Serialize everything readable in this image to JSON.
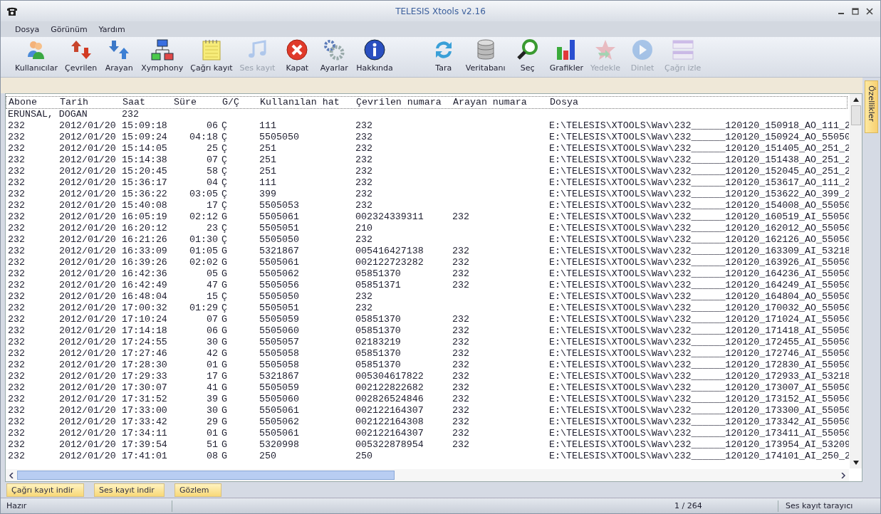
{
  "window": {
    "title": "TELESIS Xtools v2.16"
  },
  "menu": [
    "Dosya",
    "Görünüm",
    "Yardım"
  ],
  "toolbar": {
    "groups": [
      [
        {
          "label": "Kullanıcılar",
          "disabled": false
        },
        {
          "label": "Çevrilen",
          "disabled": false
        },
        {
          "label": "Arayan",
          "disabled": false
        },
        {
          "label": "Xymphony",
          "disabled": false
        },
        {
          "label": "Çağrı kayıt",
          "disabled": false
        },
        {
          "label": "Ses kayıt",
          "disabled": true
        },
        {
          "label": "Kapat",
          "disabled": false
        },
        {
          "label": "Ayarlar",
          "disabled": false
        },
        {
          "label": "Hakkında",
          "disabled": false
        }
      ],
      [
        {
          "label": "Tara",
          "disabled": false
        },
        {
          "label": "Veritabanı",
          "disabled": false
        },
        {
          "label": "Seç",
          "disabled": false
        },
        {
          "label": "Grafikler",
          "disabled": false
        },
        {
          "label": "Yedekle",
          "disabled": true
        },
        {
          "label": "Dinlet",
          "disabled": true
        },
        {
          "label": "Çağrı izle",
          "disabled": true
        }
      ]
    ]
  },
  "side_tab": "Özellikler",
  "table": {
    "columns": [
      "Abone",
      "Tarih",
      "Saat",
      "Süre",
      "G/Ç",
      "Kullanılan hat",
      "Çevrilen numara",
      "Arayan numara",
      "Dosya"
    ],
    "rows": [
      {
        "kind": "group",
        "name": "ERUNSAL, DOGAN",
        "ext": "232"
      },
      {
        "kind": "call",
        "cells": [
          "232",
          "2012/01/20",
          "15:09:18",
          "06",
          "Ç",
          "111",
          "232",
          "",
          "E:\\TELESIS\\XTOOLS\\Wav\\232______120120_150918_AO_111_2"
        ]
      },
      {
        "kind": "call",
        "cells": [
          "232",
          "2012/01/20",
          "15:09:24",
          "04:18",
          "Ç",
          "5505050",
          "232",
          "",
          "E:\\TELESIS\\XTOOLS\\Wav\\232______120120_150924_AO_55050"
        ]
      },
      {
        "kind": "call",
        "cells": [
          "232",
          "2012/01/20",
          "15:14:05",
          "25",
          "Ç",
          "251",
          "232",
          "",
          "E:\\TELESIS\\XTOOLS\\Wav\\232______120120_151405_AO_251_2"
        ]
      },
      {
        "kind": "call",
        "cells": [
          "232",
          "2012/01/20",
          "15:14:38",
          "07",
          "Ç",
          "251",
          "232",
          "",
          "E:\\TELESIS\\XTOOLS\\Wav\\232______120120_151438_AO_251_2"
        ]
      },
      {
        "kind": "call",
        "cells": [
          "232",
          "2012/01/20",
          "15:20:45",
          "58",
          "Ç",
          "251",
          "232",
          "",
          "E:\\TELESIS\\XTOOLS\\Wav\\232______120120_152045_AO_251_2"
        ]
      },
      {
        "kind": "call",
        "cells": [
          "232",
          "2012/01/20",
          "15:36:17",
          "04",
          "Ç",
          "111",
          "232",
          "",
          "E:\\TELESIS\\XTOOLS\\Wav\\232______120120_153617_AO_111_2"
        ]
      },
      {
        "kind": "call",
        "cells": [
          "232",
          "2012/01/20",
          "15:36:22",
          "03:05",
          "Ç",
          "399",
          "232",
          "",
          "E:\\TELESIS\\XTOOLS\\Wav\\232______120120_153622_AO_399_2"
        ]
      },
      {
        "kind": "call",
        "cells": [
          "232",
          "2012/01/20",
          "15:40:08",
          "17",
          "Ç",
          "5505053",
          "232",
          "",
          "E:\\TELESIS\\XTOOLS\\Wav\\232______120120_154008_AO_55050"
        ]
      },
      {
        "kind": "call",
        "cells": [
          "232",
          "2012/01/20",
          "16:05:19",
          "02:12",
          "G",
          "5505061",
          "002324339311",
          "232",
          "E:\\TELESIS\\XTOOLS\\Wav\\232______120120_160519_AI_55050"
        ]
      },
      {
        "kind": "call",
        "cells": [
          "232",
          "2012/01/20",
          "16:20:12",
          "23",
          "Ç",
          "5505051",
          "210",
          "",
          "E:\\TELESIS\\XTOOLS\\Wav\\232______120120_162012_AO_55050"
        ]
      },
      {
        "kind": "call",
        "cells": [
          "232",
          "2012/01/20",
          "16:21:26",
          "01:30",
          "Ç",
          "5505050",
          "232",
          "",
          "E:\\TELESIS\\XTOOLS\\Wav\\232______120120_162126_AO_55050"
        ]
      },
      {
        "kind": "call",
        "cells": [
          "232",
          "2012/01/20",
          "16:33:09",
          "01:05",
          "G",
          "5321867",
          "005416427138",
          "232",
          "E:\\TELESIS\\XTOOLS\\Wav\\232______120120_163309_AI_53218"
        ]
      },
      {
        "kind": "call",
        "cells": [
          "232",
          "2012/01/20",
          "16:39:26",
          "02:02",
          "G",
          "5505061",
          "002122723282",
          "232",
          "E:\\TELESIS\\XTOOLS\\Wav\\232______120120_163926_AI_55050"
        ]
      },
      {
        "kind": "call",
        "cells": [
          "232",
          "2012/01/20",
          "16:42:36",
          "05",
          "G",
          "5505062",
          "05851370",
          "232",
          "E:\\TELESIS\\XTOOLS\\Wav\\232______120120_164236_AI_55050"
        ]
      },
      {
        "kind": "call",
        "cells": [
          "232",
          "2012/01/20",
          "16:42:49",
          "47",
          "G",
          "5505056",
          "05851371",
          "232",
          "E:\\TELESIS\\XTOOLS\\Wav\\232______120120_164249_AI_55050"
        ]
      },
      {
        "kind": "call",
        "cells": [
          "232",
          "2012/01/20",
          "16:48:04",
          "15",
          "Ç",
          "5505050",
          "232",
          "",
          "E:\\TELESIS\\XTOOLS\\Wav\\232______120120_164804_AO_55050"
        ]
      },
      {
        "kind": "call",
        "cells": [
          "232",
          "2012/01/20",
          "17:00:32",
          "01:29",
          "Ç",
          "5505051",
          "232",
          "",
          "E:\\TELESIS\\XTOOLS\\Wav\\232______120120_170032_AO_55050"
        ]
      },
      {
        "kind": "call",
        "cells": [
          "232",
          "2012/01/20",
          "17:10:24",
          "07",
          "G",
          "5505059",
          "05851370",
          "232",
          "E:\\TELESIS\\XTOOLS\\Wav\\232______120120_171024_AI_55050"
        ]
      },
      {
        "kind": "call",
        "cells": [
          "232",
          "2012/01/20",
          "17:14:18",
          "06",
          "G",
          "5505060",
          "05851370",
          "232",
          "E:\\TELESIS\\XTOOLS\\Wav\\232______120120_171418_AI_55050"
        ]
      },
      {
        "kind": "call",
        "cells": [
          "232",
          "2012/01/20",
          "17:24:55",
          "30",
          "G",
          "5505057",
          "02183219",
          "232",
          "E:\\TELESIS\\XTOOLS\\Wav\\232______120120_172455_AI_55050"
        ]
      },
      {
        "kind": "call",
        "cells": [
          "232",
          "2012/01/20",
          "17:27:46",
          "42",
          "G",
          "5505058",
          "05851370",
          "232",
          "E:\\TELESIS\\XTOOLS\\Wav\\232______120120_172746_AI_55050"
        ]
      },
      {
        "kind": "call",
        "cells": [
          "232",
          "2012/01/20",
          "17:28:30",
          "01",
          "G",
          "5505058",
          "05851370",
          "232",
          "E:\\TELESIS\\XTOOLS\\Wav\\232______120120_172830_AI_55050"
        ]
      },
      {
        "kind": "call",
        "cells": [
          "232",
          "2012/01/20",
          "17:29:33",
          "17",
          "G",
          "5321867",
          "005304617822",
          "232",
          "E:\\TELESIS\\XTOOLS\\Wav\\232______120120_172933_AI_53218"
        ]
      },
      {
        "kind": "call",
        "cells": [
          "232",
          "2012/01/20",
          "17:30:07",
          "41",
          "G",
          "5505059",
          "002122822682",
          "232",
          "E:\\TELESIS\\XTOOLS\\Wav\\232______120120_173007_AI_55050"
        ]
      },
      {
        "kind": "call",
        "cells": [
          "232",
          "2012/01/20",
          "17:31:52",
          "39",
          "G",
          "5505060",
          "002826524846",
          "232",
          "E:\\TELESIS\\XTOOLS\\Wav\\232______120120_173152_AI_55050"
        ]
      },
      {
        "kind": "call",
        "cells": [
          "232",
          "2012/01/20",
          "17:33:00",
          "30",
          "G",
          "5505061",
          "002122164307",
          "232",
          "E:\\TELESIS\\XTOOLS\\Wav\\232______120120_173300_AI_55050"
        ]
      },
      {
        "kind": "call",
        "cells": [
          "232",
          "2012/01/20",
          "17:33:42",
          "29",
          "G",
          "5505062",
          "002122164308",
          "232",
          "E:\\TELESIS\\XTOOLS\\Wav\\232______120120_173342_AI_55050"
        ]
      },
      {
        "kind": "call",
        "cells": [
          "232",
          "2012/01/20",
          "17:34:11",
          "01",
          "G",
          "5505061",
          "002122164307",
          "232",
          "E:\\TELESIS\\XTOOLS\\Wav\\232______120120_173411_AI_55050"
        ]
      },
      {
        "kind": "call",
        "cells": [
          "232",
          "2012/01/20",
          "17:39:54",
          "51",
          "G",
          "5320998",
          "005322878954",
          "232",
          "E:\\TELESIS\\XTOOLS\\Wav\\232______120120_173954_AI_53209"
        ]
      },
      {
        "kind": "call",
        "cells": [
          "232",
          "2012/01/20",
          "17:41:01",
          "08",
          "G",
          "250",
          "250",
          "",
          "E:\\TELESIS\\XTOOLS\\Wav\\232______120120_174101_AI_250_2"
        ]
      }
    ]
  },
  "bottom_tabs": [
    "Çağrı kayıt indir",
    "Ses kayıt indir",
    "Gözlem"
  ],
  "status_bar": {
    "message": "Hazır",
    "count": "1 / 264",
    "mode": "Ses kayıt tarayıcı"
  }
}
